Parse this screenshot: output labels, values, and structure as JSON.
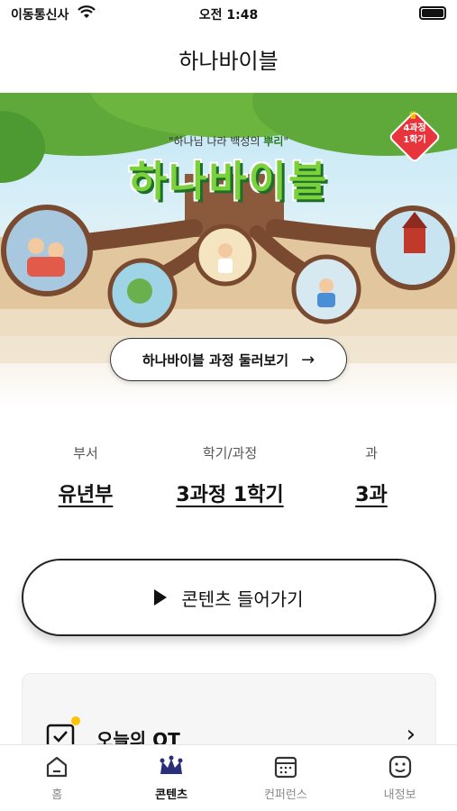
{
  "status_bar": {
    "carrier": "이동통신사",
    "time": "오전 1:48"
  },
  "nav": {
    "title": "하나바이블"
  },
  "banner": {
    "tagline_prefix": "\"하나님 나라 백성의 ",
    "tagline_emphasis": "뿌리",
    "tagline_suffix": "\"",
    "logo": "하나바이블",
    "badge_line1": "4과정",
    "badge_line2": "1학기",
    "button_label": "하나바이블 과정 둘러보기",
    "button_icon": "arrow-right-icon"
  },
  "selectors": {
    "department": {
      "label": "부서",
      "value": "유년부"
    },
    "term": {
      "label": "학기/과정",
      "value": "3과정 1학기"
    },
    "lesson": {
      "label": "과",
      "value": "3과"
    }
  },
  "enter_button": {
    "label": "콘텐츠 들어가기",
    "icon": "play-icon"
  },
  "qt_card": {
    "title": "오늘의 QT",
    "icon": "calendar-check-icon"
  },
  "tabs": [
    {
      "label": "홈",
      "icon": "home-icon",
      "active": false
    },
    {
      "label": "콘텐츠",
      "icon": "crown-icon",
      "active": true
    },
    {
      "label": "컨퍼런스",
      "icon": "calendar-icon",
      "active": false
    },
    {
      "label": "내정보",
      "icon": "smiley-icon",
      "active": false
    }
  ],
  "colors": {
    "accent": "#2a2f7a",
    "logo_green": "#7ad13a",
    "badge_red": "#e8353d",
    "qt_dot": "#ffc400"
  }
}
